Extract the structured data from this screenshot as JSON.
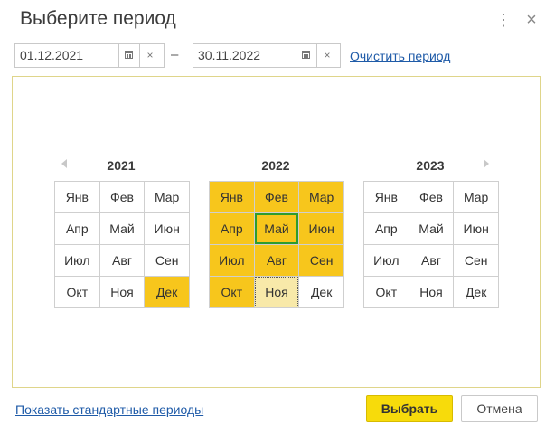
{
  "dialog": {
    "title": "Выберите период",
    "more_icon": "⋮",
    "close_icon": "×"
  },
  "period": {
    "start": "01.12.2021",
    "end": "30.11.2022",
    "separator": "–",
    "clear_field_icon": "×",
    "calendar_icon": "calendar-icon",
    "clear_link": "Очистить период"
  },
  "calendar": {
    "years": [
      {
        "label": "2021",
        "months": [
          "Янв",
          "Фев",
          "Мар",
          "Апр",
          "Май",
          "Июн",
          "Июл",
          "Авг",
          "Сен",
          "Окт",
          "Ноя",
          "Дек"
        ]
      },
      {
        "label": "2022",
        "months": [
          "Янв",
          "Фев",
          "Мар",
          "Апр",
          "Май",
          "Июн",
          "Июл",
          "Авг",
          "Сен",
          "Окт",
          "Ноя",
          "Дек"
        ]
      },
      {
        "label": "2023",
        "months": [
          "Янв",
          "Фев",
          "Мар",
          "Апр",
          "Май",
          "Июн",
          "Июл",
          "Авг",
          "Сен",
          "Окт",
          "Ноя",
          "Дек"
        ]
      }
    ],
    "selected_color": "#f7c61c",
    "current_month_border": "#2e9b2e"
  },
  "footer": {
    "standard_periods_link": "Показать стандартные периоды",
    "select_button": "Выбрать",
    "cancel_button": "Отмена"
  }
}
